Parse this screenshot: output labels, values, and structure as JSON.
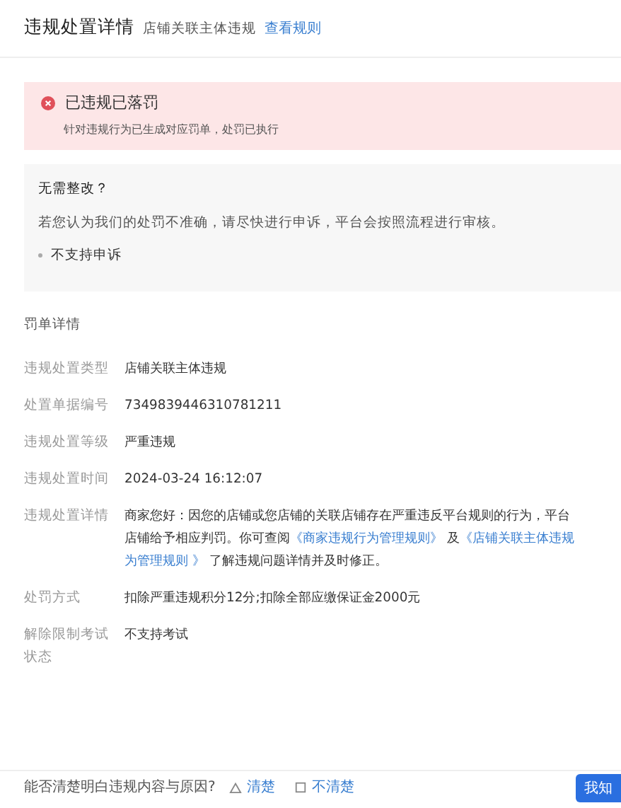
{
  "header": {
    "title": "违规处置详情",
    "subtitle": "店铺关联主体违规",
    "link": "查看规则"
  },
  "alert": {
    "kind": "error",
    "title": "已违规已落罚",
    "message": "针对违规行为已生成对应罚单，处罚已执行"
  },
  "appeal": {
    "title": "无需整改？",
    "text": "若您认为我们的处罚不准确，请尽快进行申诉，平台会按照流程进行审核。",
    "bullet": "不支持申诉"
  },
  "section_title": "罚单详情",
  "fields": [
    {
      "label": "违规处置类型",
      "lines": [
        [
          {
            "kind": "text",
            "text": "店铺关联主体违规"
          }
        ]
      ]
    },
    {
      "label": "处置单据编号",
      "lines": [
        [
          {
            "kind": "text",
            "text": "7349839446310781211"
          }
        ]
      ]
    },
    {
      "label": "违规处置等级",
      "lines": [
        [
          {
            "kind": "text",
            "text": "严重违规"
          }
        ]
      ]
    },
    {
      "label": "违规处置时间",
      "lines": [
        [
          {
            "kind": "text",
            "text": "2024-03-24 16:12:07"
          }
        ]
      ]
    },
    {
      "label": "违规处置详情",
      "lines": [
        [
          {
            "kind": "text",
            "text": "商家您好：因您的店铺或您店铺的关联店铺存在严重违反平台规则的行为，平台"
          }
        ],
        [
          {
            "kind": "text",
            "text": "店铺给予相应判罚。你可查阅"
          },
          {
            "kind": "link",
            "text": "《商家违规行为管理规则》"
          },
          {
            "kind": "text",
            "text": " 及"
          },
          {
            "kind": "link",
            "text": "《店铺关联主体违规"
          }
        ],
        [
          {
            "kind": "link",
            "text": "为管理规则 》"
          },
          {
            "kind": "text",
            "text": " 了解违规问题详情并及时修正。"
          }
        ]
      ]
    },
    {
      "label": "处罚方式",
      "lines": [
        [
          {
            "kind": "text",
            "text": "扣除严重违规积分12分;扣除全部应缴保证金2000元"
          }
        ]
      ]
    },
    {
      "label": "解除限制考试状态",
      "lines": [
        [
          {
            "kind": "text",
            "text": "不支持考试"
          }
        ]
      ]
    }
  ],
  "footer": {
    "question": "能否清楚明白违规内容与原因?",
    "options": [
      {
        "label": "清楚",
        "kind": "triangle"
      },
      {
        "label": "不清楚",
        "kind": "square"
      }
    ],
    "button": "我知"
  }
}
